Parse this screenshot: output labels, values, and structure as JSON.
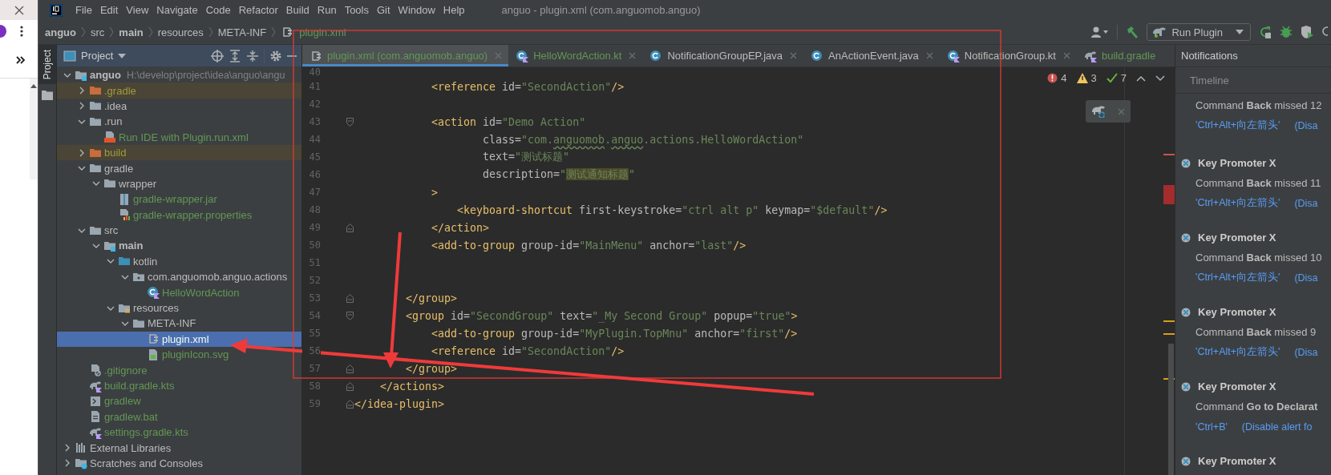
{
  "window": {
    "title": "anguo - plugin.xml (com.anguomob.anguo)"
  },
  "menu": [
    "File",
    "Edit",
    "View",
    "Navigate",
    "Code",
    "Refactor",
    "Build",
    "Run",
    "Tools",
    "Git",
    "Window",
    "Help"
  ],
  "breadcrumb": [
    {
      "label": "anguo",
      "kind": "module"
    },
    {
      "label": "src",
      "kind": "folder"
    },
    {
      "label": "main",
      "kind": "module"
    },
    {
      "label": "resources",
      "kind": "folder"
    },
    {
      "label": "META-INF",
      "kind": "folder"
    },
    {
      "label": "plugin.xml",
      "kind": "file"
    }
  ],
  "toolbar": {
    "run_config": "Run Plugin"
  },
  "tool_stripe": {
    "label": "Project"
  },
  "project": {
    "title": "Project",
    "tree": [
      {
        "label": "anguo",
        "kind": "module",
        "untracked": false,
        "ignored": false,
        "path": "H:\\develop\\project\\idea\\anguo\\angu",
        "expanded": true,
        "selected": false,
        "children": [
          {
            "label": ".gradle",
            "kind": "excluded-folder",
            "untracked": false,
            "ignored": true,
            "expanded": false,
            "selected": false
          },
          {
            "label": ".idea",
            "kind": "folder",
            "untracked": false,
            "ignored": false,
            "expanded": false,
            "selected": false
          },
          {
            "label": ".run",
            "kind": "folder",
            "untracked": false,
            "ignored": false,
            "expanded": true,
            "selected": false,
            "children": [
              {
                "label": "Run IDE with Plugin.run.xml",
                "kind": "run-config",
                "untracked": true,
                "ignored": false,
                "selected": false
              }
            ]
          },
          {
            "label": "build",
            "kind": "excluded-folder",
            "untracked": false,
            "ignored": true,
            "expanded": false,
            "selected": false
          },
          {
            "label": "gradle",
            "kind": "folder",
            "untracked": false,
            "ignored": false,
            "expanded": true,
            "selected": false,
            "children": [
              {
                "label": "wrapper",
                "kind": "folder",
                "untracked": false,
                "ignored": false,
                "expanded": true,
                "selected": false,
                "children": [
                  {
                    "label": "gradle-wrapper.jar",
                    "kind": "jar",
                    "untracked": true,
                    "ignored": false,
                    "selected": false
                  },
                  {
                    "label": "gradle-wrapper.properties",
                    "kind": "properties",
                    "untracked": true,
                    "ignored": false,
                    "selected": false
                  }
                ]
              }
            ]
          },
          {
            "label": "src",
            "kind": "folder",
            "untracked": false,
            "ignored": false,
            "expanded": true,
            "selected": false,
            "children": [
              {
                "label": "main",
                "kind": "module",
                "untracked": false,
                "ignored": false,
                "expanded": true,
                "selected": false,
                "children": [
                  {
                    "label": "kotlin",
                    "kind": "source-folder",
                    "untracked": false,
                    "ignored": false,
                    "expanded": true,
                    "selected": false,
                    "children": [
                      {
                        "label": "com.anguomob.anguo.actions",
                        "kind": "package",
                        "untracked": false,
                        "ignored": false,
                        "expanded": true,
                        "selected": false,
                        "children": [
                          {
                            "label": "HelloWordAction",
                            "kind": "kotlin-class",
                            "untracked": true,
                            "ignored": false,
                            "selected": false
                          }
                        ]
                      }
                    ]
                  },
                  {
                    "label": "resources",
                    "kind": "resources-folder",
                    "untracked": false,
                    "ignored": false,
                    "expanded": true,
                    "selected": false,
                    "children": [
                      {
                        "label": "META-INF",
                        "kind": "folder",
                        "untracked": false,
                        "ignored": false,
                        "expanded": true,
                        "selected": false,
                        "children": [
                          {
                            "label": "plugin.xml",
                            "kind": "xml",
                            "untracked": true,
                            "ignored": false,
                            "selected": true
                          },
                          {
                            "label": "pluginIcon.svg",
                            "kind": "svg",
                            "untracked": true,
                            "ignored": false,
                            "selected": false
                          }
                        ]
                      }
                    ]
                  }
                ]
              }
            ]
          },
          {
            "label": ".gitignore",
            "kind": "gitignore",
            "untracked": true,
            "ignored": false,
            "selected": false
          },
          {
            "label": "build.gradle.kts",
            "kind": "gradle-script",
            "untracked": true,
            "ignored": false,
            "selected": false
          },
          {
            "label": "gradlew",
            "kind": "shell",
            "untracked": true,
            "ignored": false,
            "selected": false
          },
          {
            "label": "gradlew.bat",
            "kind": "batch",
            "untracked": true,
            "ignored": false,
            "selected": false
          },
          {
            "label": "settings.gradle.kts",
            "kind": "gradle-script",
            "untracked": true,
            "ignored": false,
            "selected": false
          }
        ]
      },
      {
        "label": "External Libraries",
        "kind": "libraries",
        "untracked": false,
        "ignored": false,
        "expanded": false,
        "selected": false
      },
      {
        "label": "Scratches and Consoles",
        "kind": "scratches",
        "untracked": false,
        "ignored": false,
        "expanded": false,
        "selected": false
      }
    ]
  },
  "tabs": [
    {
      "label": "plugin.xml (com.anguomob.anguo)",
      "kind": "xml",
      "untracked": true,
      "selected": true
    },
    {
      "label": "HelloWordAction.kt",
      "kind": "kotlin-class",
      "untracked": true,
      "selected": false
    },
    {
      "label": "NotificationGroupEP.java",
      "kind": "java-class",
      "untracked": false,
      "selected": false
    },
    {
      "label": "AnActionEvent.java",
      "kind": "java-class",
      "untracked": false,
      "selected": false
    },
    {
      "label": "NotificationGroup.kt",
      "kind": "kotlin-class",
      "untracked": false,
      "selected": false
    },
    {
      "label": "build.gradle",
      "kind": "gradle-script",
      "untracked": true,
      "selected": false
    }
  ],
  "editor": {
    "inspections": [
      {
        "kind": "error",
        "count": "4"
      },
      {
        "kind": "warning",
        "count": "3"
      },
      {
        "kind": "ok",
        "count": "7"
      }
    ],
    "lines": [
      {
        "number": "40",
        "kind": "plain"
      },
      {
        "number": "41",
        "kind": "plain",
        "tokens": [
          {
            "kind": "tag",
            "text": "            <reference"
          },
          {
            "kind": "attr",
            "text": " id="
          },
          {
            "kind": "str",
            "text": "\"SecondAction\""
          },
          {
            "kind": "tag",
            "text": "/>"
          }
        ]
      },
      {
        "number": "42",
        "kind": "plain"
      },
      {
        "number": "43",
        "kind": "fold-start",
        "tokens": [
          {
            "kind": "tag",
            "text": "            <action"
          },
          {
            "kind": "attr",
            "text": " id="
          },
          {
            "kind": "str",
            "text": "\"Demo Action\""
          }
        ]
      },
      {
        "number": "44",
        "kind": "plain",
        "tokens": [
          {
            "kind": "attr",
            "text": "                    class="
          },
          {
            "kind": "str",
            "text": "\"com."
          },
          {
            "kind": "typo",
            "text": "anguomob"
          },
          {
            "kind": "str",
            "text": "."
          },
          {
            "kind": "typo",
            "text": "anguo"
          },
          {
            "kind": "str",
            "text": ".actions.HelloWordAction\""
          }
        ]
      },
      {
        "number": "45",
        "kind": "plain",
        "tokens": [
          {
            "kind": "attr",
            "text": "                    text="
          },
          {
            "kind": "str",
            "text": "\"测试标题\""
          }
        ]
      },
      {
        "number": "46",
        "kind": "plain",
        "tokens": [
          {
            "kind": "attr",
            "text": "                    description="
          },
          {
            "kind": "str",
            "text": "\""
          },
          {
            "kind": "match",
            "text": "测试通知标题"
          },
          {
            "kind": "str",
            "text": "\""
          }
        ]
      },
      {
        "number": "47",
        "kind": "plain",
        "tokens": [
          {
            "kind": "tag",
            "text": "            >"
          }
        ]
      },
      {
        "number": "48",
        "kind": "plain",
        "tokens": [
          {
            "kind": "tag",
            "text": "                <keyboard-shortcut"
          },
          {
            "kind": "attr",
            "text": " first-keystroke="
          },
          {
            "kind": "str",
            "text": "\"ctrl alt p\""
          },
          {
            "kind": "attr",
            "text": " keymap="
          },
          {
            "kind": "str",
            "text": "\"$default\""
          },
          {
            "kind": "tag",
            "text": "/>"
          }
        ]
      },
      {
        "number": "49",
        "kind": "fold-end",
        "tokens": [
          {
            "kind": "tag",
            "text": "            </action>"
          }
        ]
      },
      {
        "number": "50",
        "kind": "plain",
        "tokens": [
          {
            "kind": "tag",
            "text": "            <add-to-group"
          },
          {
            "kind": "attr",
            "text": " group-id="
          },
          {
            "kind": "str",
            "text": "\"MainMenu\""
          },
          {
            "kind": "attr",
            "text": " anchor="
          },
          {
            "kind": "str",
            "text": "\"last\""
          },
          {
            "kind": "tag",
            "text": "/>"
          }
        ]
      },
      {
        "number": "51",
        "kind": "plain"
      },
      {
        "number": "52",
        "kind": "plain"
      },
      {
        "number": "53",
        "kind": "fold-end",
        "tokens": [
          {
            "kind": "tag",
            "text": "        </group>"
          }
        ]
      },
      {
        "number": "54",
        "kind": "fold-start",
        "tokens": [
          {
            "kind": "tag",
            "text": "        <group"
          },
          {
            "kind": "attr",
            "text": " id="
          },
          {
            "kind": "str",
            "text": "\"SecondGroup\""
          },
          {
            "kind": "attr",
            "text": " text="
          },
          {
            "kind": "str",
            "text": "\"_My Second Group\""
          },
          {
            "kind": "attr",
            "text": " popup="
          },
          {
            "kind": "str",
            "text": "\"true\""
          },
          {
            "kind": "tag",
            "text": ">"
          }
        ]
      },
      {
        "number": "55",
        "kind": "plain",
        "tokens": [
          {
            "kind": "tag",
            "text": "            <add-to-group"
          },
          {
            "kind": "attr",
            "text": " group-id="
          },
          {
            "kind": "str",
            "text": "\"MyPlugin.TopMnu\""
          },
          {
            "kind": "attr",
            "text": " anchor="
          },
          {
            "kind": "str",
            "text": "\"first\""
          },
          {
            "kind": "tag",
            "text": "/>"
          }
        ]
      },
      {
        "number": "56",
        "kind": "plain",
        "tokens": [
          {
            "kind": "tag",
            "text": "            <reference"
          },
          {
            "kind": "attr",
            "text": " id="
          },
          {
            "kind": "str",
            "text": "\"SecondAction\""
          },
          {
            "kind": "tag",
            "text": "/>"
          }
        ]
      },
      {
        "number": "57",
        "kind": "fold-end",
        "tokens": [
          {
            "kind": "tag",
            "text": "        </group>"
          }
        ]
      },
      {
        "number": "58",
        "kind": "fold-end",
        "tokens": [
          {
            "kind": "tag",
            "text": "    </actions>"
          }
        ]
      },
      {
        "number": "59",
        "kind": "fold-end",
        "tokens": [
          {
            "kind": "tag",
            "text": "</idea-plugin>"
          }
        ]
      }
    ]
  },
  "notifications": {
    "title": "Notifications",
    "section": "Timeline",
    "entries": [
      {
        "message": "Command **Back** missed 12",
        "shortcut": "'Ctrl+Alt+向左箭头'",
        "action": "(Disa"
      },
      {
        "title": "Key Promoter X",
        "message": "Command **Back** missed 11",
        "shortcut": "'Ctrl+Alt+向左箭头'",
        "action": "(Disa"
      },
      {
        "title": "Key Promoter X",
        "message": "Command **Back** missed 10",
        "shortcut": "'Ctrl+Alt+向左箭头'",
        "action": "(Disa"
      },
      {
        "title": "Key Promoter X",
        "message": "Command **Back** missed 9",
        "shortcut": "'Ctrl+Alt+向左箭头'",
        "action": "(Disa"
      },
      {
        "title": "Key Promoter X",
        "message": "Command **Go to Declarat**",
        "shortcut": "'Ctrl+B'",
        "action": "(Disable alert fo"
      },
      {
        "title": "Key Promoter X"
      }
    ]
  }
}
